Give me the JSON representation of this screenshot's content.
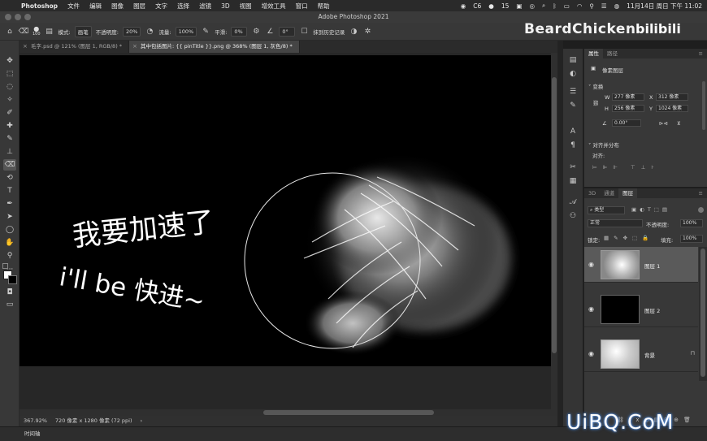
{
  "menubar": {
    "app": "Photoshop",
    "items": [
      "文件",
      "编辑",
      "图像",
      "图层",
      "文字",
      "选择",
      "滤镜",
      "3D",
      "视图",
      "增效工具",
      "窗口",
      "帮助"
    ],
    "status_c": "C6",
    "status_num": "15",
    "datetime": "11月14日 周日 下午 11:02"
  },
  "titlebar": {
    "title": "Adobe Photoshop 2021"
  },
  "options": {
    "brush_size": "100",
    "mode_label": "模式:",
    "mode_value": "画笔",
    "opacity_label": "不透明度:",
    "opacity_value": "20%",
    "flow_label": "流量:",
    "flow_value": "100%",
    "smooth_label": "平滑:",
    "smooth_value": "0%",
    "angle_value": "0°",
    "erase_history": "抹到历史记录"
  },
  "tabs": [
    {
      "label": "毛字.psd @ 121% (图层 1, RGB/8) *",
      "active": false
    },
    {
      "label": "其中包括图片: {{ pinTitle }}.png @ 368% (图层 1, 灰色/8) *",
      "active": true
    }
  ],
  "canvas": {
    "line1": "我要加速了",
    "line2": "i'll be 快进~"
  },
  "status": {
    "zoom": "367.92%",
    "doc": "720 像素 x 1280 像素 (72 ppi)"
  },
  "timeline": {
    "label": "时间轴"
  },
  "properties": {
    "tabs": [
      "属性",
      "路径"
    ],
    "kind": "像素图层",
    "transform_label": "变换",
    "w_label": "W",
    "w_value": "277 像素",
    "x_label": "X",
    "x_value": "312 像素",
    "h_label": "H",
    "h_value": "256 像素",
    "y_label": "Y",
    "y_value": "1024 像素",
    "angle_value": "0.00°",
    "align_label": "对齐并分布",
    "align_sub": "对齐:"
  },
  "layers_panel": {
    "tabs": [
      "3D",
      "通道",
      "图层"
    ],
    "filter": "类型",
    "blend": "正常",
    "opacity_label": "不透明度:",
    "opacity_value": "100%",
    "lock_label": "锁定:",
    "fill_label": "填充:",
    "fill_value": "100%",
    "layers": [
      {
        "name": "图层 1",
        "selected": true
      },
      {
        "name": "图层 2",
        "selected": false
      },
      {
        "name": "背景",
        "selected": false
      }
    ]
  },
  "watermarks": {
    "beardchicken": "BeardChicken",
    "bilibili": "bilibili",
    "uibq": "UiBQ.CoM"
  }
}
